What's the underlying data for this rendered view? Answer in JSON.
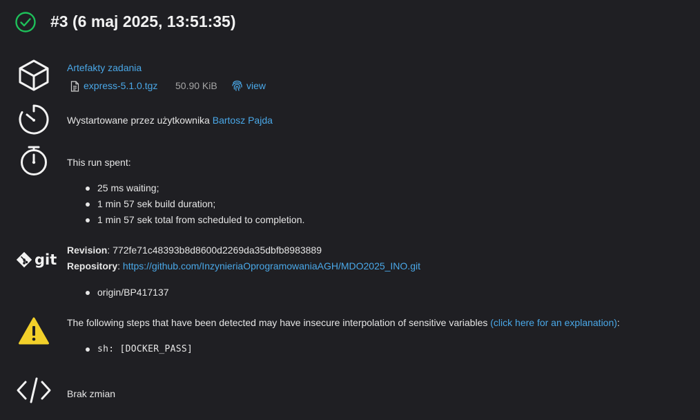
{
  "header": {
    "status": "success",
    "title": "#3 (6 maj 2025, 13:51:35)"
  },
  "artifacts": {
    "heading": "Artefakty zadania",
    "file_name": "express-5.1.0.tgz",
    "file_size": "50.90 KiB",
    "view_label": "view"
  },
  "started_by": {
    "prefix": "Wystartowane przez użytkownika ",
    "user": "Bartosz Pajda"
  },
  "timing": {
    "heading": "This run spent:",
    "items": [
      "25 ms waiting;",
      "1 min 57 sek build duration;",
      "1 min 57 sek total from scheduled to completion."
    ]
  },
  "git": {
    "logo_text": "git",
    "revision_label": "Revision",
    "revision_value": ": 772fe71c48393b8d8600d2269da35dbfb8983889",
    "repository_label": "Repository",
    "repository_sep": ": ",
    "repository_url": "https://github.com/InzynieriaOprogramowaniaAGH/MDO2025_INO.git",
    "branches": [
      "origin/BP417137"
    ]
  },
  "warning": {
    "text": "The following steps that have been detected may have insecure interpolation of sensitive variables ",
    "link": "(click here for an explanation)",
    "suffix": ":",
    "steps": [
      "sh: [DOCKER_PASS]"
    ]
  },
  "changes": {
    "text": "Brak zmian"
  },
  "colors": {
    "background": "#1f1f23",
    "link": "#4aa8e8",
    "success": "#1ec05a",
    "warning": "#f2d02a"
  }
}
